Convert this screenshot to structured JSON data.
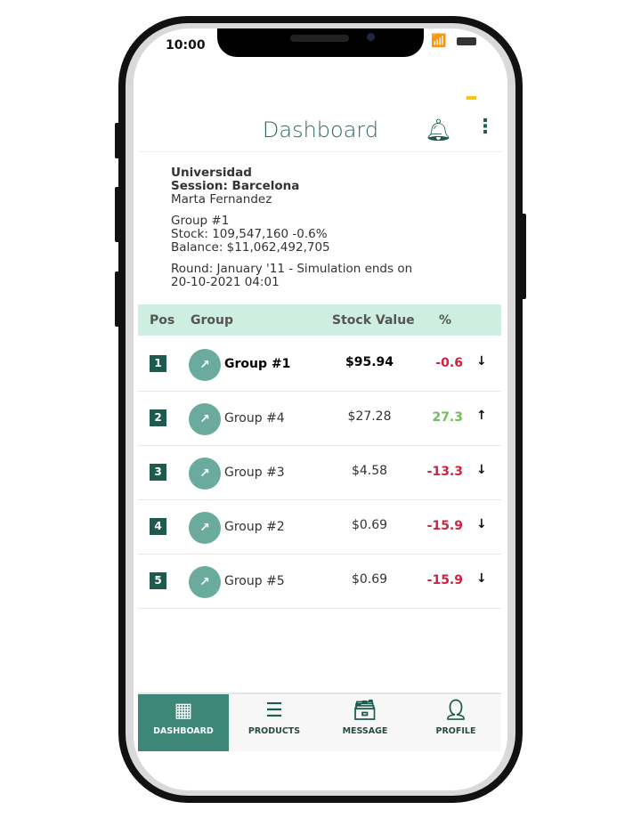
{
  "status_bar": {
    "time": "10:00"
  },
  "header": {
    "title": "Dashboard"
  },
  "info": {
    "org": "Universidad",
    "session": "Session: Barcelona",
    "user": "Marta Fernandez",
    "group": "Group #1",
    "stock": "Stock: 109,547,160  -0.6%",
    "balance": "Balance: $11,062,492,705",
    "round": "Round: January '11 - Simulation ends on",
    "ends": "20-10-2021 04:01"
  },
  "table": {
    "headers": [
      "Pos",
      "Group",
      "Stock Value",
      "%"
    ],
    "rows": [
      {
        "pos": "1",
        "group": "Group #1",
        "value": "$95.94",
        "pct": "-0.6",
        "trend": "down",
        "highlight": true
      },
      {
        "pos": "2",
        "group": "Group #4",
        "value": "$27.28",
        "pct": "27.3",
        "trend": "up"
      },
      {
        "pos": "3",
        "group": "Group #3",
        "value": "$4.58",
        "pct": "-13.3",
        "trend": "down"
      },
      {
        "pos": "4",
        "group": "Group #2",
        "value": "$0.69",
        "pct": "-15.9",
        "trend": "down"
      },
      {
        "pos": "5",
        "group": "Group #5",
        "value": "$0.69",
        "pct": "-15.9",
        "trend": "down"
      }
    ]
  },
  "nav": [
    {
      "label": "DASHBOARD",
      "icon": "building-icon",
      "active": true
    },
    {
      "label": "PRODUCTS",
      "icon": "server-icon"
    },
    {
      "label": "MESSAGE",
      "icon": "inbox-icon"
    },
    {
      "label": "PROFILE",
      "icon": "user-icon"
    }
  ],
  "colors": {
    "accent": "#3d8678",
    "negative": "#d0223f",
    "positive": "#6cbf5a",
    "header_band": "#cdeee0"
  }
}
